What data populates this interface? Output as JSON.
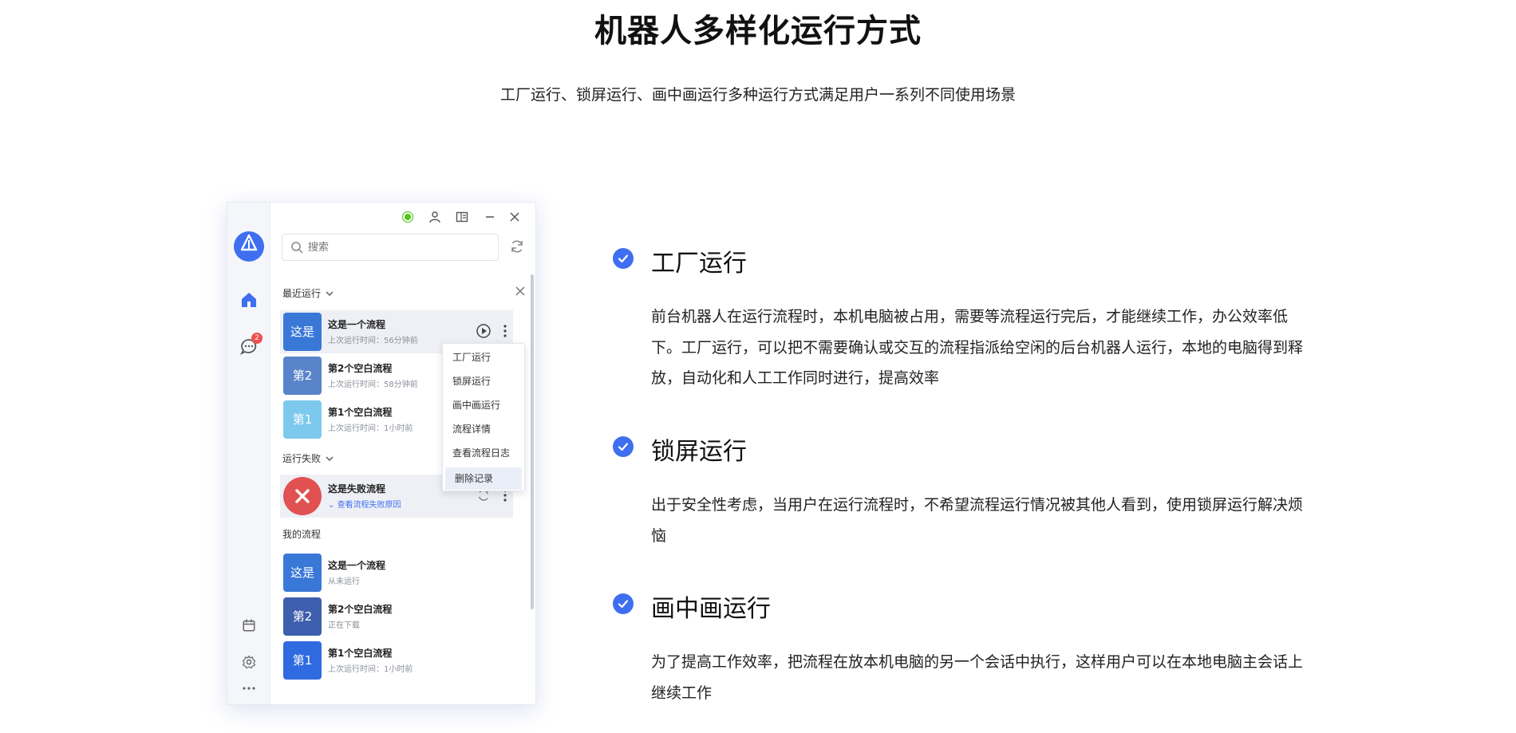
{
  "hero": {
    "title": "机器人多样化运行方式",
    "subtitle": "工厂运行、锁屏运行、画中画运行多种运行方式满足用户一系列不同使用场景"
  },
  "app": {
    "logo_text": "A",
    "status_color": "#52c41a",
    "accent_color": "#3f6ff0",
    "message_badge": "2",
    "search": {
      "placeholder": "搜索"
    },
    "recent": {
      "label": "最近运行",
      "items": [
        {
          "thumb": "这是",
          "title": "这是一个流程",
          "sub": "上次运行时间：56分钟前",
          "color": "#3a78d8"
        },
        {
          "thumb": "第2",
          "title": "第2个空白流程",
          "sub": "上次运行时间：58分钟前",
          "color": "#5a84c9"
        },
        {
          "thumb": "第1",
          "title": "第1个空白流程",
          "sub": "上次运行时间：1小时前",
          "color": "#7dc9ee"
        }
      ]
    },
    "failed": {
      "label": "运行失败",
      "items": [
        {
          "title": "这是失败流程",
          "sub": "查看流程失败原因"
        }
      ]
    },
    "mine": {
      "label": "我的流程",
      "items": [
        {
          "thumb": "这是",
          "title": "这是一个流程",
          "sub": "从未运行",
          "color": "#3a78d8"
        },
        {
          "thumb": "第2",
          "title": "第2个空白流程",
          "sub": "正在下载",
          "color": "#3e5fae"
        },
        {
          "thumb": "第1",
          "title": "第1个空白流程",
          "sub": "上次运行时间：1小时前",
          "color": "#2f6ae0"
        }
      ]
    },
    "context_menu": {
      "items": [
        "工厂运行",
        "锁屏运行",
        "画中画运行",
        "流程详情",
        "查看流程日志",
        "删除记录"
      ],
      "active_index": 5
    }
  },
  "features": [
    {
      "title": "工厂运行",
      "desc": "前台机器人在运行流程时，本机电脑被占用，需要等流程运行完后，才能继续工作，办公效率低下。工厂运行，可以把不需要确认或交互的流程指派给空闲的后台机器人运行，本地的电脑得到释放，自动化和人工工作同时进行，提高效率"
    },
    {
      "title": "锁屏运行",
      "desc": "出于安全性考虑，当用户在运行流程时，不希望流程运行情况被其他人看到，使用锁屏运行解决烦恼"
    },
    {
      "title": "画中画运行",
      "desc": "为了提高工作效率，把流程在放本机电脑的另一个会话中执行，这样用户可以在本地电脑主会话上继续工作"
    }
  ]
}
